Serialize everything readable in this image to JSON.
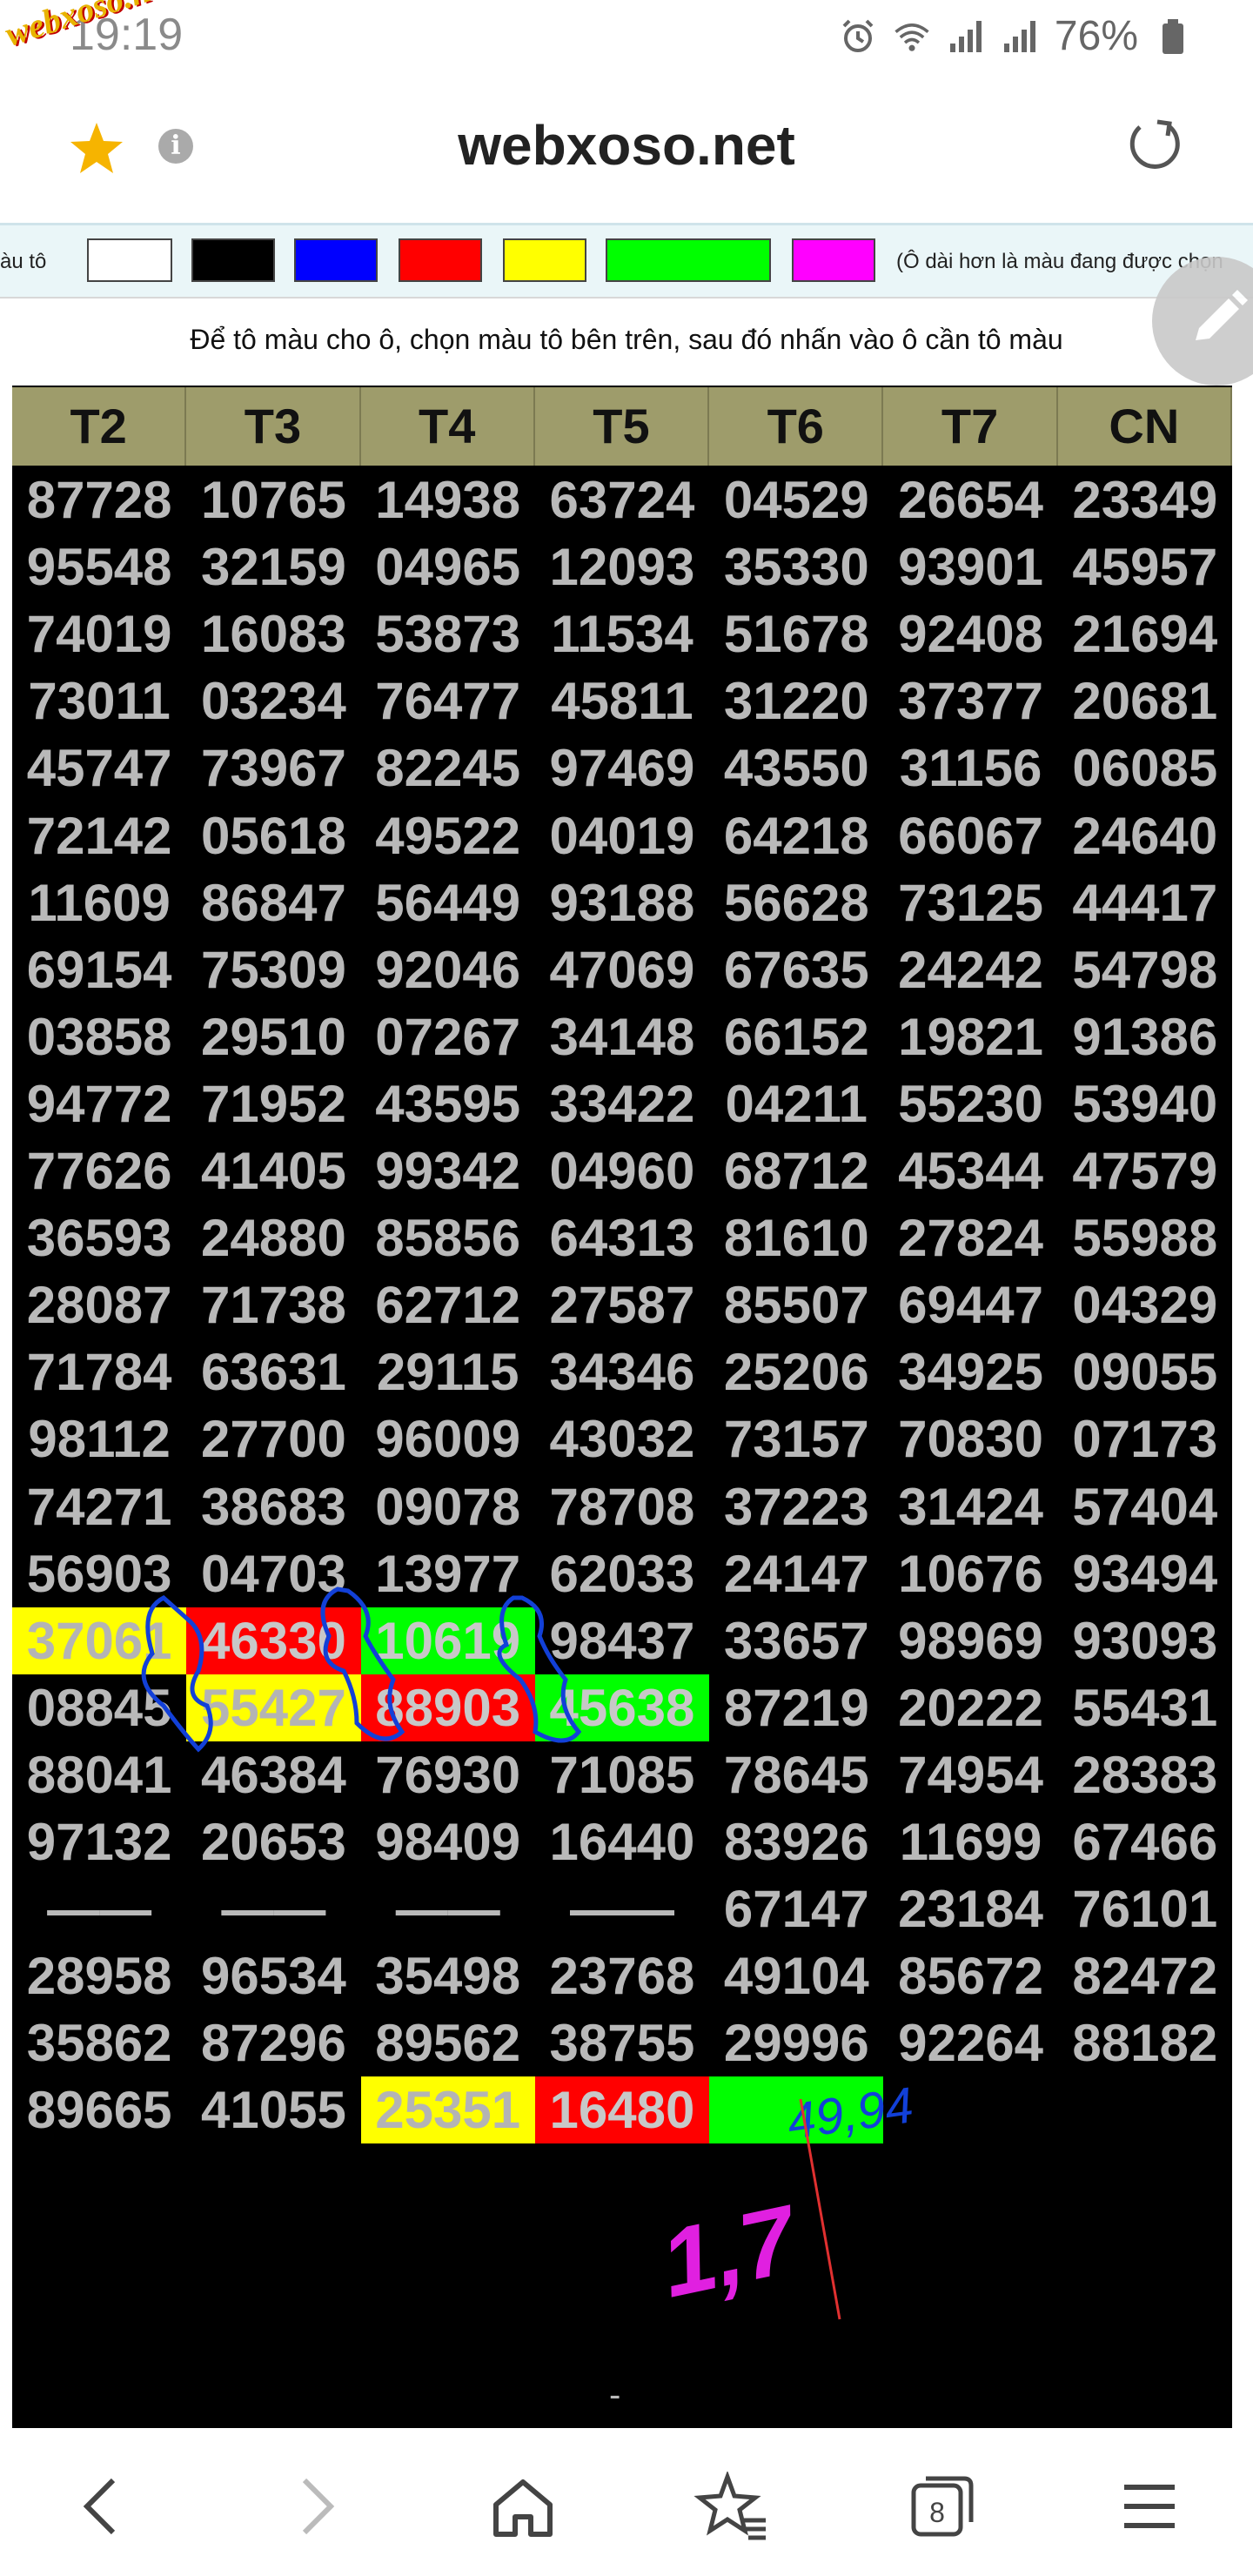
{
  "status": {
    "time": "19:19",
    "battery": "76%",
    "watermark": "webxoso.net"
  },
  "browser": {
    "url": "webxoso.net",
    "tabs_count": "8"
  },
  "colorbar": {
    "label": "àu tô",
    "note": "(Ô dài hơn là màu đang được chọn",
    "swatches": [
      "#ffffff",
      "#000000",
      "#0000ff",
      "#ff0000",
      "#ffff00",
      "#00ff00",
      "#ff00ff"
    ]
  },
  "instructions": "Để tô màu cho ô, chọn màu tô bên trên, sau đó nhấn vào ô cần tô màu",
  "headers": [
    "T2",
    "T3",
    "T4",
    "T5",
    "T6",
    "T7",
    "CN"
  ],
  "rows": [
    [
      "87728",
      "10765",
      "14938",
      "63724",
      "04529",
      "26654",
      "23349"
    ],
    [
      "95548",
      "32159",
      "04965",
      "12093",
      "35330",
      "93901",
      "45957"
    ],
    [
      "74019",
      "16083",
      "53873",
      "11534",
      "51678",
      "92408",
      "21694"
    ],
    [
      "73011",
      "03234",
      "76477",
      "45811",
      "31220",
      "37377",
      "20681"
    ],
    [
      "45747",
      "73967",
      "82245",
      "97469",
      "43550",
      "31156",
      "06085"
    ],
    [
      "72142",
      "05618",
      "49522",
      "04019",
      "64218",
      "66067",
      "24640"
    ],
    [
      "11609",
      "86847",
      "56449",
      "93188",
      "56628",
      "73125",
      "44417"
    ],
    [
      "69154",
      "75309",
      "92046",
      "47069",
      "67635",
      "24242",
      "54798"
    ],
    [
      "03858",
      "29510",
      "07267",
      "34148",
      "66152",
      "19821",
      "91386"
    ],
    [
      "94772",
      "71952",
      "43595",
      "33422",
      "04211",
      "55230",
      "53940"
    ],
    [
      "77626",
      "41405",
      "99342",
      "04960",
      "68712",
      "45344",
      "47579"
    ],
    [
      "36593",
      "24880",
      "85856",
      "64313",
      "81610",
      "27824",
      "55988"
    ],
    [
      "28087",
      "71738",
      "62712",
      "27587",
      "85507",
      "69447",
      "04329"
    ],
    [
      "71784",
      "63631",
      "29115",
      "34346",
      "25206",
      "34925",
      "09055"
    ],
    [
      "98112",
      "27700",
      "96009",
      "43032",
      "73157",
      "70830",
      "07173"
    ],
    [
      "74271",
      "38683",
      "09078",
      "78708",
      "37223",
      "31424",
      "57404"
    ],
    [
      "56903",
      "04703",
      "13977",
      "62033",
      "24147",
      "10676",
      "93494"
    ],
    [
      "37061",
      "46330",
      "10619",
      "98437",
      "33657",
      "98969",
      "93093"
    ],
    [
      "08845",
      "55427",
      "88903",
      "45638",
      "87219",
      "20222",
      "55431"
    ],
    [
      "88041",
      "46384",
      "76930",
      "71085",
      "78645",
      "74954",
      "28383"
    ],
    [
      "97132",
      "20653",
      "98409",
      "16440",
      "83926",
      "11699",
      "67466"
    ],
    [
      "——",
      "——",
      "——",
      "——",
      "67147",
      "23184",
      "76101"
    ],
    [
      "28958",
      "96534",
      "35498",
      "23768",
      "49104",
      "85672",
      "82472"
    ],
    [
      "35862",
      "87296",
      "89562",
      "38755",
      "29996",
      "92264",
      "88182"
    ],
    [
      "89665",
      "41055",
      "25351",
      "16480",
      "",
      "",
      ""
    ]
  ],
  "cell_colors": {
    "17-0": "#ffff00",
    "17-1": "#ff0000",
    "17-2": "#00ff00",
    "18-1": "#ffff00",
    "18-2": "#ff0000",
    "18-3": "#00ff00",
    "24-2": "#ffff00",
    "24-3": "#ff0000",
    "24-4": "#00ff00"
  },
  "annotations": {
    "blue_text": "49,94",
    "magenta_text": "1,7"
  },
  "footer_dash": "-"
}
